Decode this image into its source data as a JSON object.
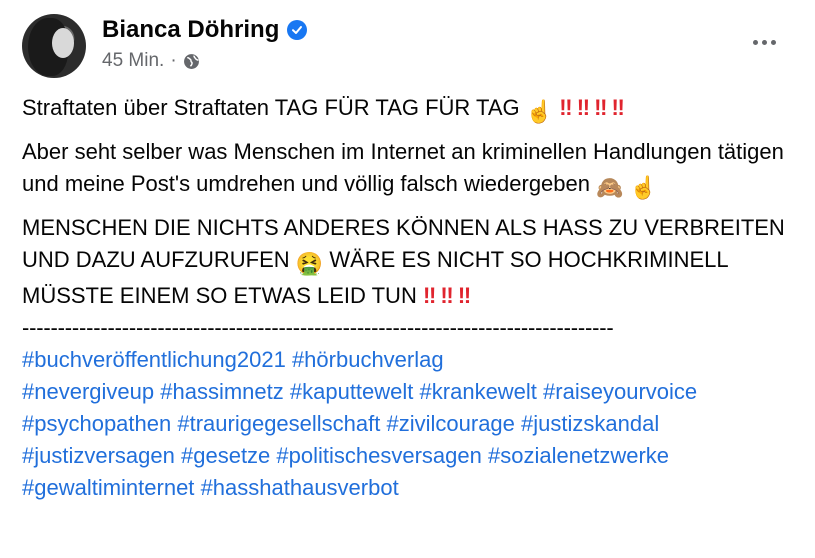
{
  "post": {
    "author": "Bianca Döhring",
    "time": "45 Min.",
    "separator": "·",
    "line1": "Straftaten über Straftaten TAG FÜR TAG FÜR TAG",
    "line2": "Aber seht selber was Menschen im Internet an kriminellen Handlungen tätigen und meine Post's umdrehen und völlig falsch wiedergeben",
    "line3a": "MENSCHEN DIE NICHTS ANDERES KÖNNEN ALS HASS ZU VERBREITEN UND DAZU AUFZURUFEN",
    "line3b": "WÄRE ES NICHT SO HOCHKRIMINELL MÜSSTE EINEM SO ETWAS LEID TUN",
    "dashes": "-----------------------------------------------------------------------------------",
    "hashtags": [
      "#buchveröffentlichung2021",
      "#hörbuchverlag",
      "#nevergiveup",
      "#hassimnetz",
      "#kaputtewelt",
      "#krankewelt",
      "#raiseyourvoice",
      "#psychopathen",
      "#traurigegesellschaft",
      "#zivilcourage",
      "#justizskandal",
      "#justizversagen",
      "#gesetze",
      "#politischesversagen",
      "#sozialenetzwerke",
      "#gewaltiminternet",
      "#hasshathausverbot"
    ],
    "emojis": {
      "finger": "☝",
      "bang": "‼",
      "monkey": "🙈",
      "vomit": "🤮"
    },
    "colors": {
      "link": "#216fdb",
      "verified": "#1877f2",
      "meta": "#65676b",
      "bang": "#e0242e"
    }
  }
}
